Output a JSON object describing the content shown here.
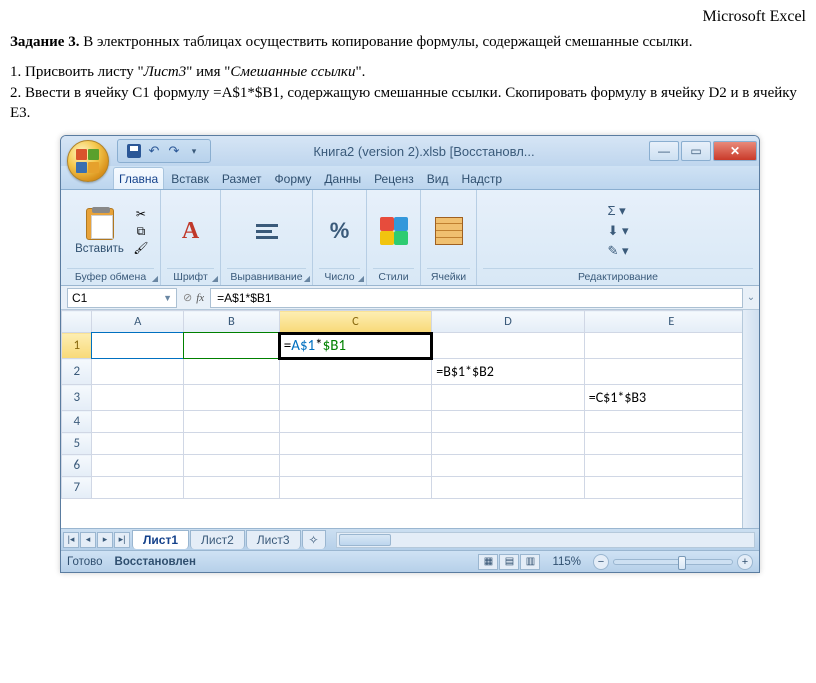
{
  "doc": {
    "header_right": "Microsoft Excel",
    "task_label": "Задание 3.",
    "task_desc": "В электронных таблицах осуществить копирование формулы, содержащей смешанные ссылки.",
    "step1_a": "1. Присвоить листу \"",
    "step1_i1": "Лист3",
    "step1_b": "\" имя \"",
    "step1_i2": "Смешанные ссылки",
    "step1_c": "\".",
    "step2": "2. Ввести в ячейку C1 формулу =A$1*$B1, содержащую смешанные ссылки. Скопировать формулу в ячейку D2 и в ячейку E3."
  },
  "excel": {
    "title": "Книга2 (version 2).xlsb [Восстановл...",
    "tabs": [
      "Главна",
      "Вставк",
      "Размет",
      "Форму",
      "Данны",
      "Реценз",
      "Вид",
      "Надстр"
    ],
    "groups": {
      "clipboard": "Буфер обмена",
      "paste": "Вставить",
      "font": "Шрифт",
      "align": "Выравнивание",
      "number": "Число",
      "styles": "Стили",
      "cells": "Ячейки",
      "editing": "Редактирование"
    },
    "namebox": "C1",
    "formula": "=A$1*$B1",
    "cols": [
      "A",
      "B",
      "C",
      "D",
      "E"
    ],
    "rows": [
      "1",
      "2",
      "3",
      "4",
      "5",
      "6",
      "7"
    ],
    "cells": {
      "C1_eq": "=",
      "C1_ref1": "A$1",
      "C1_star": "*",
      "C1_ref2": "$B1",
      "D2": "=B$1*$B2",
      "E3": "=C$1*$B3"
    },
    "sheets": [
      "Лист1",
      "Лист2",
      "Лист3"
    ],
    "status": {
      "ready": "Готово",
      "recovered": "Восстановлен",
      "zoom": "115%"
    }
  }
}
